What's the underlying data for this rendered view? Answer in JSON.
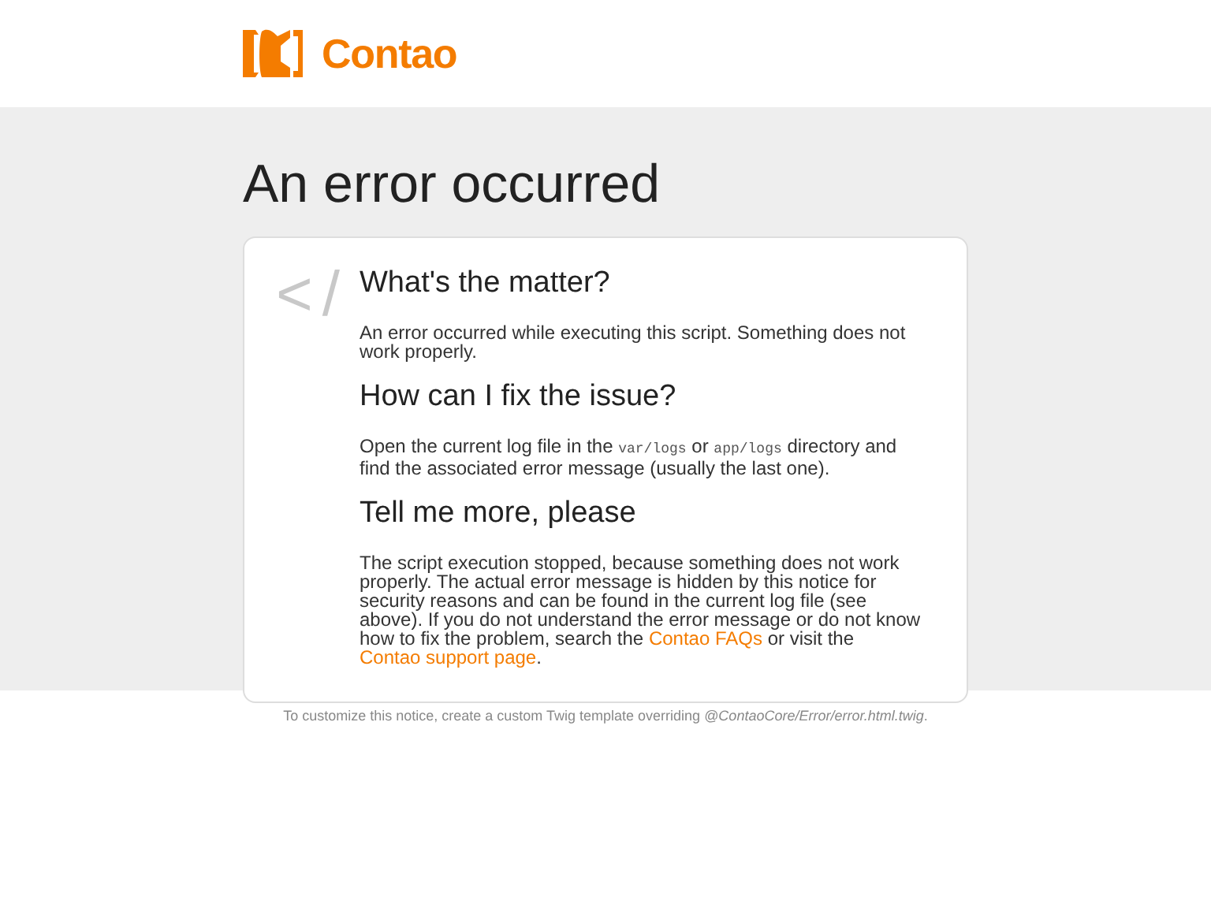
{
  "header": {
    "logo_text": "Contao"
  },
  "title": "An error occurred",
  "card": {
    "symbol": "</",
    "sections": [
      {
        "heading": "What's the matter?",
        "parts": [
          {
            "kind": "text",
            "text": "An error occurred while executing this script. Something does not work properly."
          }
        ]
      },
      {
        "heading": "How can I fix the issue?",
        "parts": [
          {
            "kind": "text",
            "text": "Open the current log file in the "
          },
          {
            "kind": "code",
            "text": "var/logs"
          },
          {
            "kind": "text",
            "text": " or "
          },
          {
            "kind": "code",
            "text": "app/logs"
          },
          {
            "kind": "text",
            "text": " directory and find the associated error message (usually the last one)."
          }
        ]
      },
      {
        "heading": "Tell me more, please",
        "parts": [
          {
            "kind": "text",
            "text": "The script execution stopped, because something does not work properly. The actual error message is hidden by this notice for security reasons and can be found in the current log file (see above). If you do not understand the error message or do not know how to fix the problem, search the "
          },
          {
            "kind": "link",
            "text": "Contao FAQs"
          },
          {
            "kind": "text",
            "text": " or visit the "
          },
          {
            "kind": "link",
            "text": "Contao support page"
          },
          {
            "kind": "text",
            "text": "."
          }
        ]
      }
    ]
  },
  "footer": "To customize this notice, create a custom Twig template overriding *@ContaoCore/Error/error.html.twig*."
}
